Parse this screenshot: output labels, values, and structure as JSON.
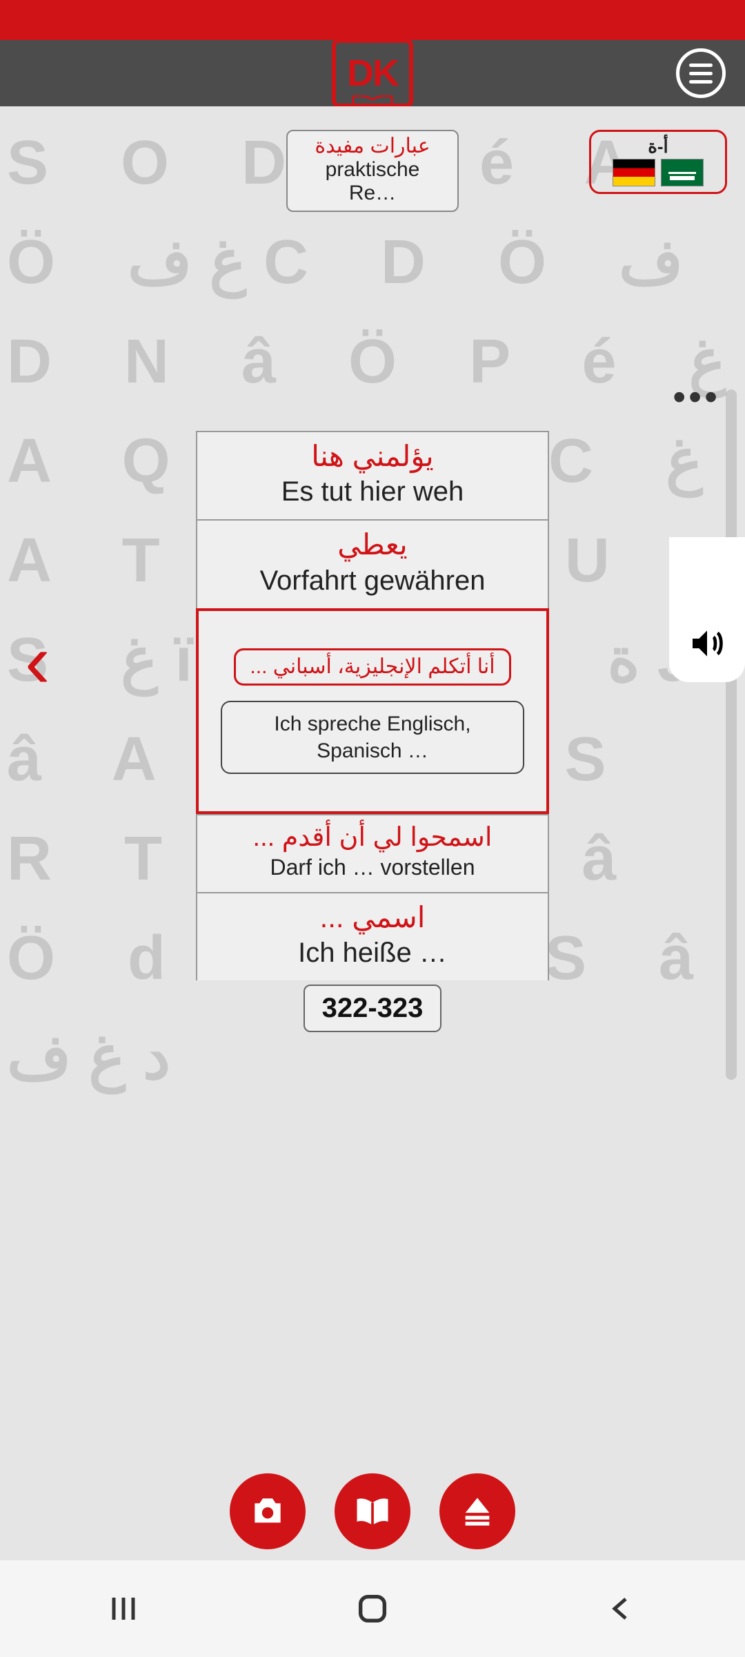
{
  "header": {
    "logo_text": "DK"
  },
  "category": {
    "ar": "عبارات مفيدة",
    "de": "praktische Re…"
  },
  "lang_selector": {
    "label": "أ-ة"
  },
  "overflow_dots": "•••",
  "cards": [
    {
      "ar": "يؤلمني هنا",
      "de": "Es tut hier weh"
    },
    {
      "ar": "يعطي",
      "de": "Vorfahrt gewähren"
    },
    {
      "ar": "... أنا أتكلم الإنجليزية، أسباني",
      "de": "Ich spreche Englisch, Spanisch …",
      "selected": true
    },
    {
      "ar": "... اسمحوا لي أن أقدم",
      "de": "Darf ich … vorstellen"
    },
    {
      "ar": "... اسمي",
      "de": "Ich heiße …"
    }
  ],
  "page_range": "322-323",
  "nav": {
    "left": "‹",
    "right": "›"
  }
}
